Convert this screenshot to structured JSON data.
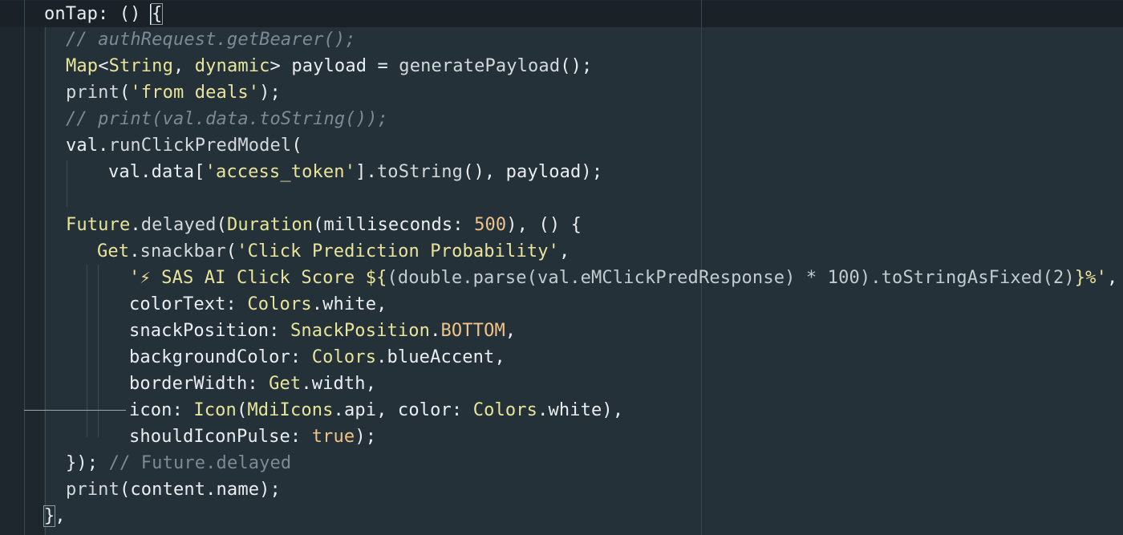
{
  "editor": {
    "colors": {
      "background": "#253139",
      "current_line": "#1a2228",
      "comment": "#7b8b94",
      "type": "#e7e59a",
      "string": "#e8e49c",
      "number": "#f0c38a",
      "text": "#eaeef0"
    },
    "lines": [
      {
        "tokens": [
          {
            "t": "onTap: () ",
            "k": "plain"
          },
          {
            "t": "{",
            "k": "plain",
            "cursor": true
          }
        ]
      },
      {
        "tokens": [
          {
            "t": "// authRequest.getBearer();",
            "k": "comment"
          }
        ]
      },
      {
        "tokens": [
          {
            "t": "Map",
            "k": "type"
          },
          {
            "t": "<",
            "k": "plain"
          },
          {
            "t": "String",
            "k": "type"
          },
          {
            "t": ", ",
            "k": "plain"
          },
          {
            "t": "dynamic",
            "k": "type"
          },
          {
            "t": "> payload = ",
            "k": "plain"
          },
          {
            "t": "generatePayload",
            "k": "func"
          },
          {
            "t": "();",
            "k": "plain"
          }
        ]
      },
      {
        "tokens": [
          {
            "t": "print",
            "k": "func"
          },
          {
            "t": "(",
            "k": "plain"
          },
          {
            "t": "'from deals'",
            "k": "string"
          },
          {
            "t": ");",
            "k": "plain"
          }
        ]
      },
      {
        "tokens": [
          {
            "t": "// print(val.data.toString());",
            "k": "comment"
          }
        ]
      },
      {
        "tokens": [
          {
            "t": "val.",
            "k": "plain"
          },
          {
            "t": "runClickPredModel",
            "k": "func"
          },
          {
            "t": "(",
            "k": "plain"
          }
        ]
      },
      {
        "tokens": [
          {
            "t": "val.data[",
            "k": "plain"
          },
          {
            "t": "'access_token'",
            "k": "string"
          },
          {
            "t": "].",
            "k": "plain"
          },
          {
            "t": "toString",
            "k": "func"
          },
          {
            "t": "(), payload);",
            "k": "plain"
          }
        ]
      },
      {
        "tokens": []
      },
      {
        "tokens": [
          {
            "t": "Future",
            "k": "type"
          },
          {
            "t": ".",
            "k": "plain"
          },
          {
            "t": "delayed",
            "k": "func"
          },
          {
            "t": "(",
            "k": "plain"
          },
          {
            "t": "Duration",
            "k": "type"
          },
          {
            "t": "(milliseconds: ",
            "k": "plain"
          },
          {
            "t": "500",
            "k": "number"
          },
          {
            "t": "), () {",
            "k": "plain"
          }
        ]
      },
      {
        "tokens": [
          {
            "t": "Get",
            "k": "type"
          },
          {
            "t": ".",
            "k": "plain"
          },
          {
            "t": "snackbar",
            "k": "func"
          },
          {
            "t": "(",
            "k": "plain"
          },
          {
            "t": "'Click Prediction Probability'",
            "k": "string"
          },
          {
            "t": ",",
            "k": "plain"
          }
        ]
      },
      {
        "tokens": [
          {
            "t": "'⚡ SAS AI Click Score ${",
            "k": "string"
          },
          {
            "t": "(double.parse(val.eMClickPredResponse) * 100).toStringAsFixed(2)",
            "k": "interp"
          },
          {
            "t": "}%'",
            "k": "string"
          },
          {
            "t": ",",
            "k": "plain"
          }
        ]
      },
      {
        "tokens": [
          {
            "t": "colorText: ",
            "k": "plain"
          },
          {
            "t": "Colors",
            "k": "type"
          },
          {
            "t": ".white,",
            "k": "plain"
          }
        ]
      },
      {
        "tokens": [
          {
            "t": "snackPosition: ",
            "k": "plain"
          },
          {
            "t": "SnackPosition",
            "k": "type"
          },
          {
            "t": ".",
            "k": "plain"
          },
          {
            "t": "BOTTOM",
            "k": "number"
          },
          {
            "t": ",",
            "k": "plain"
          }
        ]
      },
      {
        "tokens": [
          {
            "t": "backgroundColor: ",
            "k": "plain"
          },
          {
            "t": "Colors",
            "k": "type"
          },
          {
            "t": ".blueAccent,",
            "k": "plain"
          }
        ]
      },
      {
        "tokens": [
          {
            "t": "borderWidth: ",
            "k": "plain"
          },
          {
            "t": "Get",
            "k": "type"
          },
          {
            "t": ".width,",
            "k": "plain"
          }
        ]
      },
      {
        "tokens": [
          {
            "t": "icon: ",
            "k": "plain"
          },
          {
            "t": "Icon",
            "k": "type"
          },
          {
            "t": "(",
            "k": "plain"
          },
          {
            "t": "MdiIcons",
            "k": "type"
          },
          {
            "t": ".api, color: ",
            "k": "plain"
          },
          {
            "t": "Colors",
            "k": "type"
          },
          {
            "t": ".white),",
            "k": "plain"
          }
        ]
      },
      {
        "tokens": [
          {
            "t": "shouldIconPulse: ",
            "k": "plain"
          },
          {
            "t": "true",
            "k": "bool"
          },
          {
            "t": ");",
            "k": "plain"
          }
        ]
      },
      {
        "tokens": [
          {
            "t": "}); ",
            "k": "plain"
          },
          {
            "t": "// Future.delayed",
            "k": "comment-plain"
          }
        ]
      },
      {
        "tokens": [
          {
            "t": "print",
            "k": "func"
          },
          {
            "t": "(content.name);",
            "k": "plain"
          }
        ]
      },
      {
        "tokens": [
          {
            "t": "}",
            "k": "plain",
            "box": true
          },
          {
            "t": ",",
            "k": "plain"
          }
        ]
      }
    ]
  }
}
